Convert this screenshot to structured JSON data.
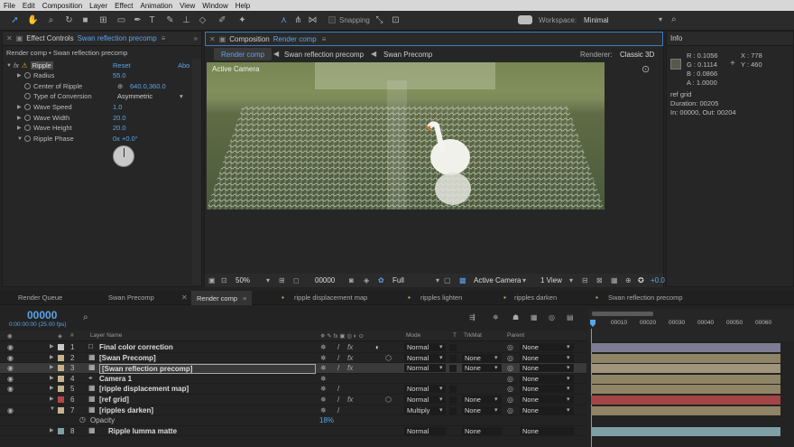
{
  "menu": [
    "File",
    "Edit",
    "Composition",
    "Layer",
    "Effect",
    "Animation",
    "View",
    "Window",
    "Help"
  ],
  "toolbar": {
    "snapping": "Snapping",
    "workspace_label": "Workspace:",
    "workspace_value": "Minimal"
  },
  "effect_controls": {
    "title_prefix": "Effect Controls",
    "title_layer": "Swan reflection precomp",
    "breadcrumb_comp": "Render comp",
    "breadcrumb_sep": " • ",
    "breadcrumb_layer": "Swan reflection precomp",
    "effect_name": "Ripple",
    "reset": "Reset",
    "about": "Abo",
    "props": [
      {
        "name": "Radius",
        "value": "55.0"
      },
      {
        "name": "Center of Ripple",
        "value": "640.0,360.0"
      },
      {
        "name": "Type of Conversion",
        "value": "Asymmetric"
      },
      {
        "name": "Wave Speed",
        "value": "1.0"
      },
      {
        "name": "Wave Width",
        "value": "20.0"
      },
      {
        "name": "Wave Height",
        "value": "20.0"
      },
      {
        "name": "Ripple Phase",
        "value": "0x +0.0°"
      }
    ]
  },
  "composition": {
    "title_prefix": "Composition",
    "title_comp": "Render comp",
    "tabs": [
      "Render comp",
      "Swan reflection precomp",
      "Swan Precomp"
    ],
    "renderer_label": "Renderer:",
    "renderer_value": "Classic 3D",
    "active_camera": "Active Camera",
    "footer": {
      "zoom": "50%",
      "timecode": "00000",
      "resolution": "Full",
      "view": "Active Camera",
      "views": "1 View",
      "offset": "+0.0"
    }
  },
  "info": {
    "title": "Info",
    "r": "R : 0.1056",
    "g": "G : 0.1114",
    "b": "B : 0.0866",
    "a": "A : 1.0000",
    "x": "X : 778",
    "y": "Y : 460",
    "layer": "ref grid",
    "duration": "Duration: 00205",
    "inout": "In: 00000, Out: 00204"
  },
  "timeline": {
    "tabs": [
      "Render Queue",
      "Swan Precomp",
      "Render comp",
      "ripple displacement map",
      "ripples lighten",
      "ripples darken",
      "Swan reflection precomp"
    ],
    "timecode": "00000",
    "timecode_sub": "0:00:00:00 (25.00 fps)",
    "headers": {
      "num": "#",
      "layer_name": "Layer Name",
      "mode": "Mode",
      "t": "T",
      "trkmat": "TrkMat",
      "parent": "Parent"
    },
    "ruler": [
      "00010",
      "00020",
      "00030",
      "00040",
      "00050",
      "00060"
    ],
    "layers": [
      {
        "num": "1",
        "name": "Final color correction",
        "mode": "Normal",
        "trkmat": "",
        "parent": "None",
        "color": "#c9c9c9",
        "bar": "#7d7c92"
      },
      {
        "num": "2",
        "name": "[Swan Precomp]",
        "mode": "Normal",
        "trkmat": "None",
        "parent": "None",
        "color": "#c4b48a",
        "bar": "#8f8466"
      },
      {
        "num": "3",
        "name": "[Swan reflection precomp]",
        "mode": "Normal",
        "trkmat": "None",
        "parent": "None",
        "color": "#c4b48a",
        "bar": "#a0957a"
      },
      {
        "num": "4",
        "name": "Camera 1",
        "mode": "",
        "trkmat": "",
        "parent": "None",
        "color": "#c4b48a",
        "bar": "#8f8466"
      },
      {
        "num": "5",
        "name": "[ripple displacement map]",
        "mode": "Normal",
        "trkmat": "",
        "parent": "None",
        "color": "#c4b48a",
        "bar": "#8f8466"
      },
      {
        "num": "6",
        "name": "[ref grid]",
        "mode": "Normal",
        "trkmat": "None",
        "parent": "None",
        "color": "#b84444",
        "bar": "#a44545"
      },
      {
        "num": "7",
        "name": "[ripples darken]",
        "mode": "Multiply",
        "trkmat": "None",
        "parent": "None",
        "color": "#c4b48a",
        "bar": "#8f8466"
      }
    ],
    "opacity_label": "Opacity",
    "opacity_value": "18%",
    "layer8": {
      "num": "8",
      "name": "Ripple lumma matte",
      "mode": "Normal",
      "trkmat": "None",
      "parent": "None"
    }
  }
}
